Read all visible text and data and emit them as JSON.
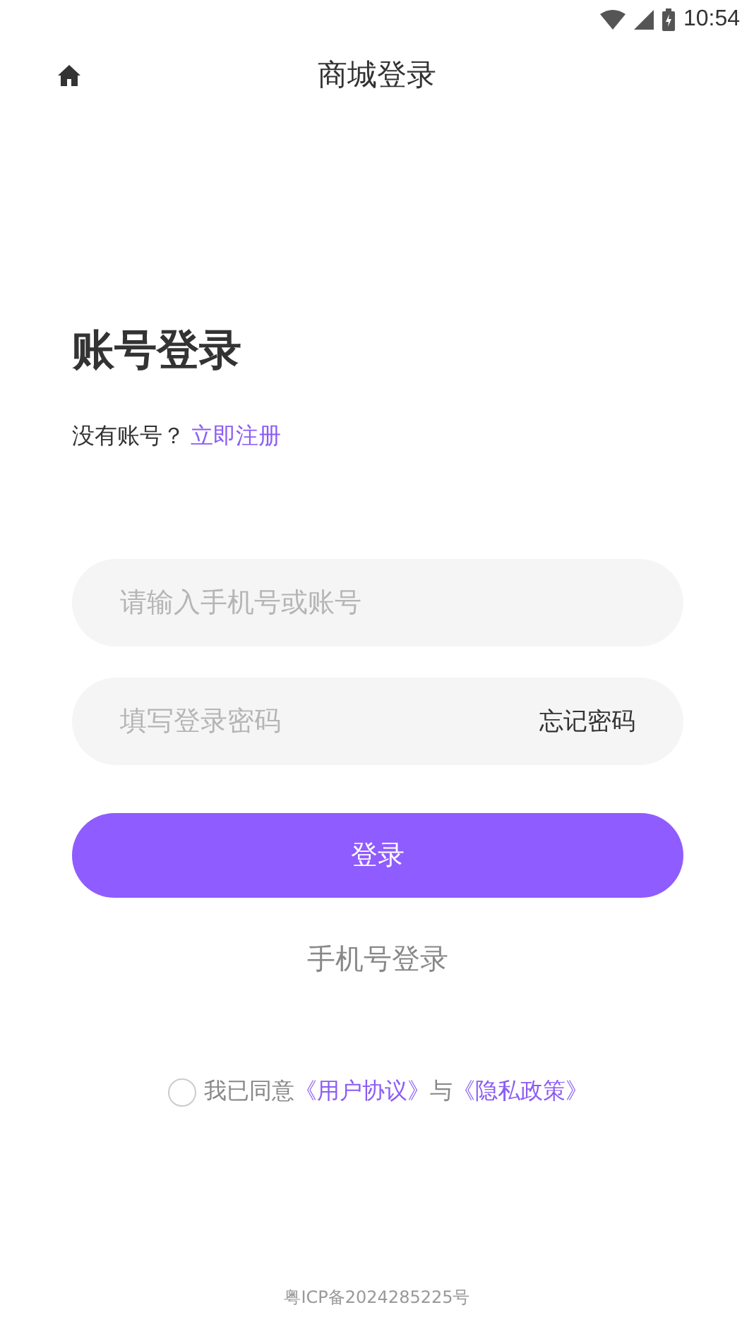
{
  "status_bar": {
    "time": "10:54"
  },
  "header": {
    "title": "商城登录"
  },
  "heading": "账号登录",
  "register": {
    "prompt": "没有账号？",
    "link": "立即注册"
  },
  "fields": [
    {
      "kind": "text",
      "placeholder": "请输入手机号或账号"
    },
    {
      "kind": "password",
      "placeholder": "填写登录密码",
      "action": "忘记密码"
    }
  ],
  "login_button": "登录",
  "alt_login": "手机号登录",
  "agreement": {
    "checked": false,
    "parts": [
      {
        "kind": "text",
        "text": "我已同意"
      },
      {
        "kind": "link",
        "text": "《用户协议》"
      },
      {
        "kind": "text",
        "text": "与"
      },
      {
        "kind": "link",
        "text": "《隐私政策》"
      }
    ]
  },
  "footer": "粤ICP备2024285225号"
}
